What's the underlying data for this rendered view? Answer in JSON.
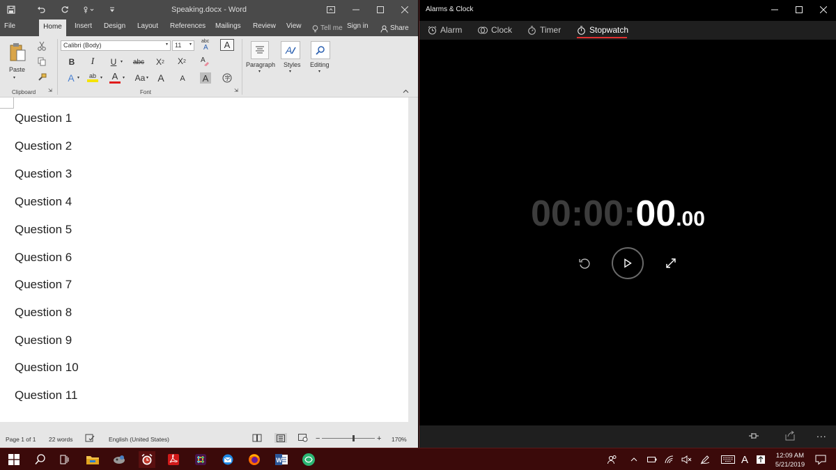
{
  "word": {
    "title": "Speaking.docx  -  Word",
    "tabs": [
      "File",
      "Home",
      "Insert",
      "Design",
      "Layout",
      "References",
      "Mailings",
      "Review",
      "View"
    ],
    "tell_me": "Tell me",
    "sign_in": "Sign in",
    "share": "Share",
    "ribbon": {
      "paste": "Paste",
      "clipboard": "Clipboard",
      "font_name": "Calibri (Body)",
      "font_size": "11",
      "font_group": "Font",
      "paragraph": "Paragraph",
      "styles": "Styles",
      "editing": "Editing",
      "bold": "B",
      "italic": "I",
      "underline": "U",
      "strike": "abc",
      "sub": "X",
      "sup": "X",
      "font_color": "A",
      "highlight": "ab",
      "change_case": "Aa",
      "grow": "A",
      "shrink": "A",
      "clear_fmt": "A",
      "char_border": "A"
    },
    "document": {
      "lines": [
        "Question 1",
        "Question 2",
        "Question 3",
        "Question 4",
        "Question 5",
        "Question 6",
        "Question 7",
        "Question 8",
        "Question 9",
        "Question 10",
        "Question 11"
      ]
    },
    "status": {
      "page": "Page 1 of 1",
      "words": "22 words",
      "language": "English (United States)",
      "zoom": "170%"
    }
  },
  "clock": {
    "title": "Alarms & Clock",
    "nav": [
      "Alarm",
      "Clock",
      "Timer",
      "Stopwatch"
    ],
    "active_nav": "Stopwatch",
    "stopwatch": {
      "hours": "00",
      "minutes": "00",
      "seconds": "00",
      "hundredths": ".00",
      "sep": ":"
    },
    "more": "..."
  },
  "taskbar": {
    "time": "12:09 AM",
    "date": "5/21/2019",
    "ime": "A"
  },
  "colors": {
    "word_title": "#4a4a4a",
    "taskbar": "#3b0a0a",
    "accent_red": "#e03030"
  }
}
